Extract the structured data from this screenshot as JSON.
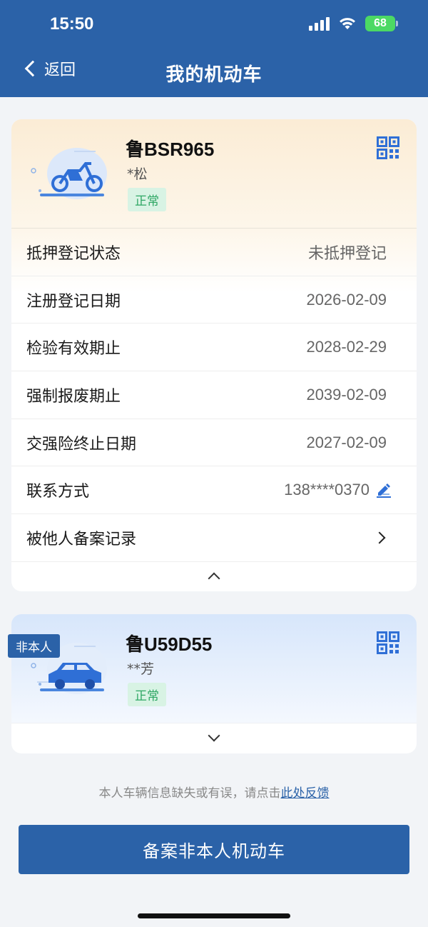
{
  "status_bar": {
    "time": "15:50",
    "battery": "68"
  },
  "header": {
    "back_label": "返回",
    "title": "我的机动车"
  },
  "vehicles": [
    {
      "plate": "鲁BSR965",
      "owner": "*松",
      "status": "正常",
      "icon": "motorcycle-icon",
      "details": [
        {
          "label": "抵押登记状态",
          "value": "未抵押登记"
        },
        {
          "label": "注册登记日期",
          "value": "2026-02-09"
        },
        {
          "label": "检验有效期止",
          "value": "2028-02-29"
        },
        {
          "label": "强制报废期止",
          "value": "2039-02-09"
        },
        {
          "label": "交强险终止日期",
          "value": "2027-02-09"
        },
        {
          "label": "联系方式",
          "value": "138****0370"
        },
        {
          "label": "被他人备案记录",
          "value": ""
        }
      ]
    },
    {
      "tag": "非本人",
      "plate": "鲁U59D55",
      "owner": "**芳",
      "status": "正常",
      "icon": "car-icon"
    }
  ],
  "feedback": {
    "text": "本人车辆信息缺失或有误，请点击",
    "link": "此处反馈"
  },
  "primary_button": {
    "label": "备案非本人机动车"
  },
  "colors": {
    "primary": "#2b62a8",
    "badge_green": "#2ea764",
    "badge_bg": "#d8f3e4"
  }
}
